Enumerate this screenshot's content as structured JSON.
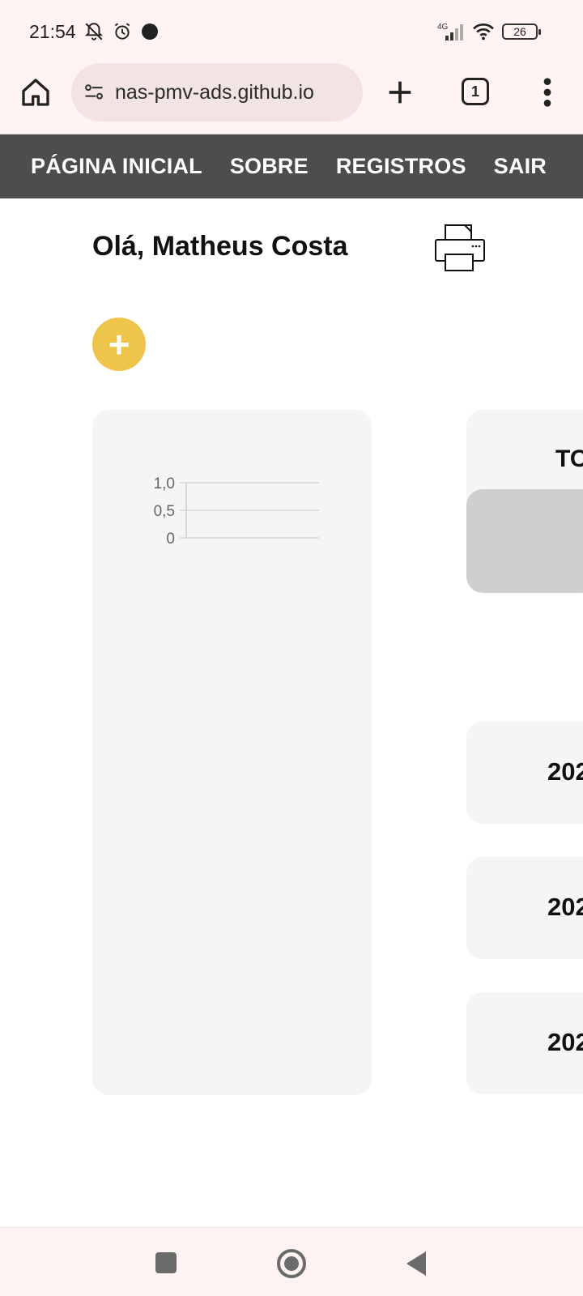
{
  "status_bar": {
    "time": "21:54",
    "network": "4G",
    "battery": "26",
    "icons": [
      "notifications-off-icon",
      "alarm-icon",
      "dot-icon",
      "signal-icon",
      "wifi-icon",
      "battery-icon"
    ]
  },
  "browser": {
    "url": "nas-pmv-ads.github.io",
    "tab_count": "1",
    "icons": [
      "home-icon",
      "site-settings-icon",
      "plus-icon",
      "tabs-icon",
      "more-vert-icon"
    ]
  },
  "nav": {
    "items": [
      {
        "label": "PÁGINA INICIAL"
      },
      {
        "label": "SOBRE"
      },
      {
        "label": "REGISTROS"
      },
      {
        "label": "SAIR"
      }
    ]
  },
  "main": {
    "greeting": "Olá, Matheus Costa",
    "print_icon": "printer-icon",
    "add_label": "+",
    "total_label": "TO",
    "records": [
      {
        "label": "202"
      },
      {
        "label": "202"
      },
      {
        "label": "202"
      }
    ]
  },
  "chart_data": {
    "type": "line",
    "y_tick_labels": [
      "1,0",
      "0,5",
      "0"
    ],
    "ylim": [
      0,
      1
    ],
    "series": [],
    "grid": true
  },
  "colors": {
    "nav_bg": "#4d4d4d",
    "add_button": "#efc44a",
    "card_bg": "#f5f5f7",
    "browser_bg": "#fff4f2"
  }
}
